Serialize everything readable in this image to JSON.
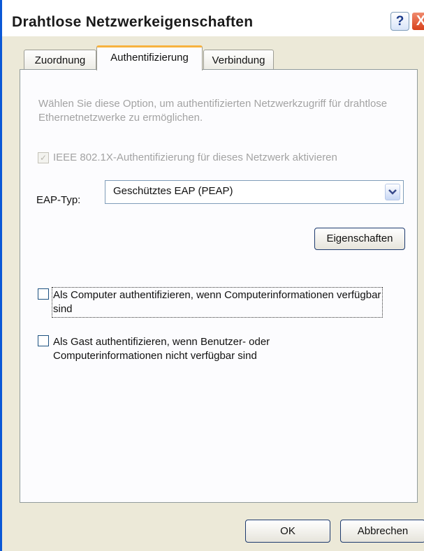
{
  "window": {
    "title": "Drahtlose Netzwerkeigenschaften",
    "help_glyph": "?",
    "close_glyph": "X"
  },
  "tabs": [
    {
      "label": "Zuordnung",
      "active": false
    },
    {
      "label": "Authentifizierung",
      "active": true
    },
    {
      "label": "Verbindung",
      "active": false
    }
  ],
  "auth": {
    "description": "Wählen Sie diese Option, um authentifizierten Netzwerkzugriff für drahtlose Ethernetnetzwerke zu ermöglichen.",
    "ieee_checkbox": {
      "label": "IEEE 802.1X-Authentifizierung für dieses Netzwerk aktivieren",
      "checked": true,
      "enabled": false
    },
    "eap_label": "EAP-Typ:",
    "eap_value": "Geschütztes EAP (PEAP)",
    "properties_button": "Eigenschaften",
    "computer_checkbox": {
      "label": "Als Computer authentifizieren, wenn Computerinformationen verfügbar sind",
      "checked": false
    },
    "guest_checkbox": {
      "label": "Als Gast authentifizieren, wenn Benutzer- oder Computerinformationen nicht verfügbar sind",
      "checked": false
    }
  },
  "footer": {
    "ok_label": "OK",
    "cancel_label": "Abbrechen"
  },
  "colors": {
    "dialog_background": "#ece9d8",
    "active_tab_accent": "#f7b23e",
    "close_button": "#d8411a",
    "frame_blue": "#0b58d6"
  }
}
